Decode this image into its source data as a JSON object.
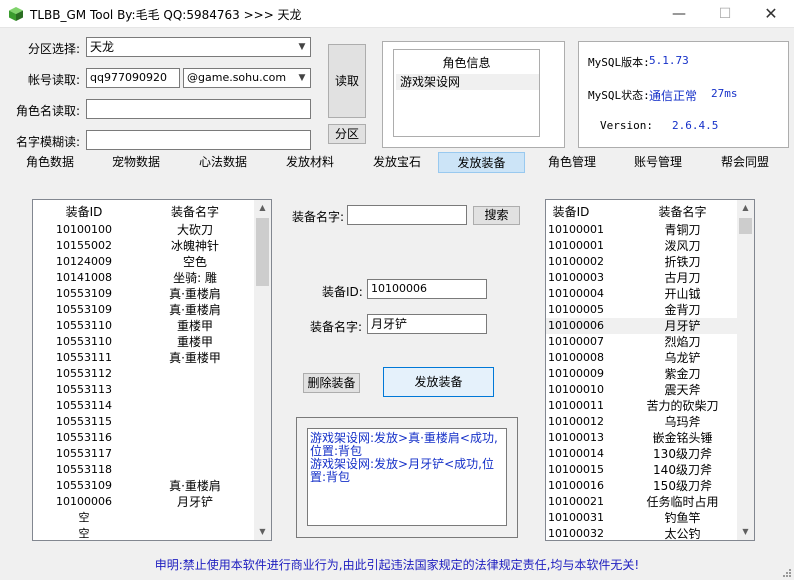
{
  "window": {
    "title": "TLBB_GM Tool By:毛毛 QQ:5984763 >>> 天龙",
    "minimize": "—",
    "maximize": "☐",
    "close": "✕"
  },
  "top": {
    "zone_label": "分区选择:",
    "zone_value": "天龙",
    "account_label": "帐号读取:",
    "account_value": "qq977090920",
    "domain_value": "@game.sohu.com",
    "role_read_label": "角色名读取:",
    "fuzzy_label": "名字模糊读:",
    "read_button": "读取",
    "zone_button": "分区"
  },
  "role_info": {
    "title": "角色信息",
    "name": "游戏架设网"
  },
  "mysql": {
    "version_label": "MySQL版本:",
    "version_value": "5.1.73",
    "status_label": "MySQL状态:",
    "status_value": "通信正常",
    "status_ms": "27ms",
    "ver_label": "Version:",
    "ver_value": "2.6.4.5"
  },
  "tabs": [
    "角色数据",
    "宠物数据",
    "心法数据",
    "发放材料",
    "发放宝石",
    "发放装备",
    "角色管理",
    "账号管理",
    "帮会同盟"
  ],
  "left_list": {
    "col_id": "装备ID",
    "col_name": "装备名字",
    "rows": [
      [
        "10100100",
        "大砍刀"
      ],
      [
        "10155002",
        "冰魄神针"
      ],
      [
        "10124009",
        "空色"
      ],
      [
        "10141008",
        "坐骑: 雕"
      ],
      [
        "10553109",
        "真·重楼肩"
      ],
      [
        "10553109",
        "真·重楼肩"
      ],
      [
        "10553110",
        "重楼甲"
      ],
      [
        "10553110",
        "重楼甲"
      ],
      [
        "10553111",
        "真·重楼甲"
      ],
      [
        "10553112",
        ""
      ],
      [
        "10553113",
        ""
      ],
      [
        "10553114",
        ""
      ],
      [
        "10553115",
        ""
      ],
      [
        "10553116",
        ""
      ],
      [
        "10553117",
        ""
      ],
      [
        "10553118",
        ""
      ],
      [
        "10553109",
        "真·重楼肩"
      ],
      [
        "10100006",
        "月牙铲"
      ],
      [
        "空",
        ""
      ],
      [
        "空",
        ""
      ]
    ]
  },
  "middle": {
    "search_label": "装备名字:",
    "search_button": "搜索",
    "id_label": "装备ID:",
    "id_value": "10100006",
    "name_label": "装备名字:",
    "name_value": "月牙铲",
    "delete_button": "删除装备",
    "issue_button": "发放装备",
    "log_lines": [
      "游戏架设网:发放>真·重楼肩<成功,位置:背包",
      "游戏架设网:发放>月牙铲<成功,位置:背包"
    ]
  },
  "right_list": {
    "col_id": "装备ID",
    "col_name": "装备名字",
    "rows": [
      [
        "10100001",
        "青铜刀"
      ],
      [
        "10100001",
        "泼风刀"
      ],
      [
        "10100002",
        "折铁刀"
      ],
      [
        "10100003",
        "古月刀"
      ],
      [
        "10100004",
        "开山钺"
      ],
      [
        "10100005",
        "金背刀"
      ],
      [
        "10100006",
        "月牙铲"
      ],
      [
        "10100007",
        "烈焰刀"
      ],
      [
        "10100008",
        "乌龙铲"
      ],
      [
        "10100009",
        "紫金刀"
      ],
      [
        "10100010",
        "震天斧"
      ],
      [
        "10100011",
        "苦力的砍柴刀"
      ],
      [
        "10100012",
        "乌玛斧"
      ],
      [
        "10100013",
        "嵌金铭头锤"
      ],
      [
        "10100014",
        "130级刀斧"
      ],
      [
        "10100015",
        "140级刀斧"
      ],
      [
        "10100016",
        "150级刀斧"
      ],
      [
        "10100021",
        "任务临时占用"
      ],
      [
        "10100031",
        "钓鱼竿"
      ],
      [
        "10100032",
        "太公钓"
      ]
    ]
  },
  "footer": "申明:禁止使用本软件进行商业行为,由此引起违法国家规定的法律规定责任,均与本软件无关!"
}
